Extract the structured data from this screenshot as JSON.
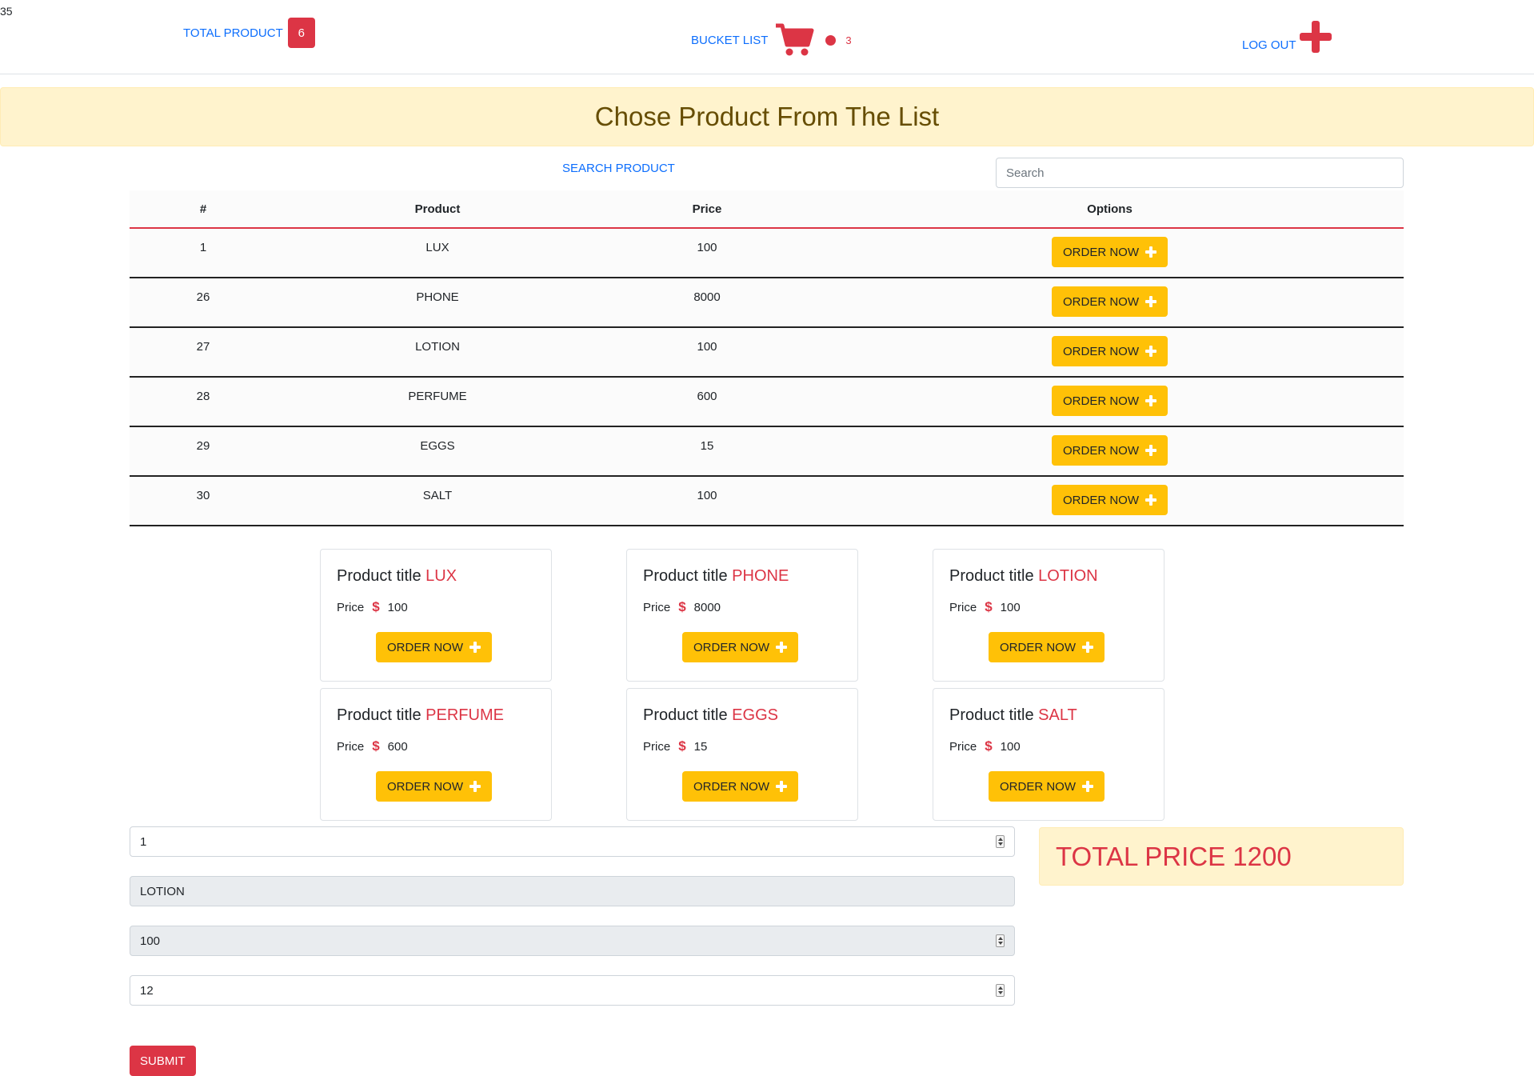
{
  "corner_number": "35",
  "nav": {
    "total_product_label": "TOTAL PRODUCT",
    "total_product_count": "6",
    "bucket_list_label": "BUCKET LIST",
    "bucket_count": "3",
    "logout_label": "LOG OUT",
    "icons": [
      "cart-icon",
      "dot-icon",
      "plus-icon"
    ]
  },
  "banner": {
    "title": "Chose Product From The List"
  },
  "search": {
    "label": "SEARCH PRODUCT",
    "placeholder": "Search"
  },
  "table": {
    "headers": [
      "#",
      "Product",
      "Price",
      "Options"
    ],
    "rows": [
      {
        "id": "1",
        "product": "LUX",
        "price": "100",
        "action": "ORDER NOW"
      },
      {
        "id": "26",
        "product": "PHONE",
        "price": "8000",
        "action": "ORDER NOW"
      },
      {
        "id": "27",
        "product": "LOTION",
        "price": "100",
        "action": "ORDER NOW"
      },
      {
        "id": "28",
        "product": "PERFUME",
        "price": "600",
        "action": "ORDER NOW"
      },
      {
        "id": "29",
        "product": "EGGS",
        "price": "15",
        "action": "ORDER NOW"
      },
      {
        "id": "30",
        "product": "SALT",
        "price": "100",
        "action": "ORDER NOW"
      }
    ]
  },
  "cards": {
    "title_prefix": "Product title",
    "price_label": "Price",
    "currency": "$",
    "button_label": "ORDER NOW",
    "items": [
      {
        "name": "LUX",
        "price": "100"
      },
      {
        "name": "PHONE",
        "price": "8000"
      },
      {
        "name": "LOTION",
        "price": "100"
      },
      {
        "name": "PERFUME",
        "price": "600"
      },
      {
        "name": "EGGS",
        "price": "15"
      },
      {
        "name": "SALT",
        "price": "100"
      }
    ]
  },
  "form": {
    "quantity": "1",
    "product": "LOTION",
    "price": "100",
    "extra": "12",
    "submit_label": "SUBMIT"
  },
  "total": {
    "label": "TOTAL PRICE 1200"
  },
  "colors": {
    "accent_red": "#dc3545",
    "button_yellow": "#ffc107",
    "link_blue": "#0d6efd",
    "banner_bg": "#fff3cd"
  }
}
